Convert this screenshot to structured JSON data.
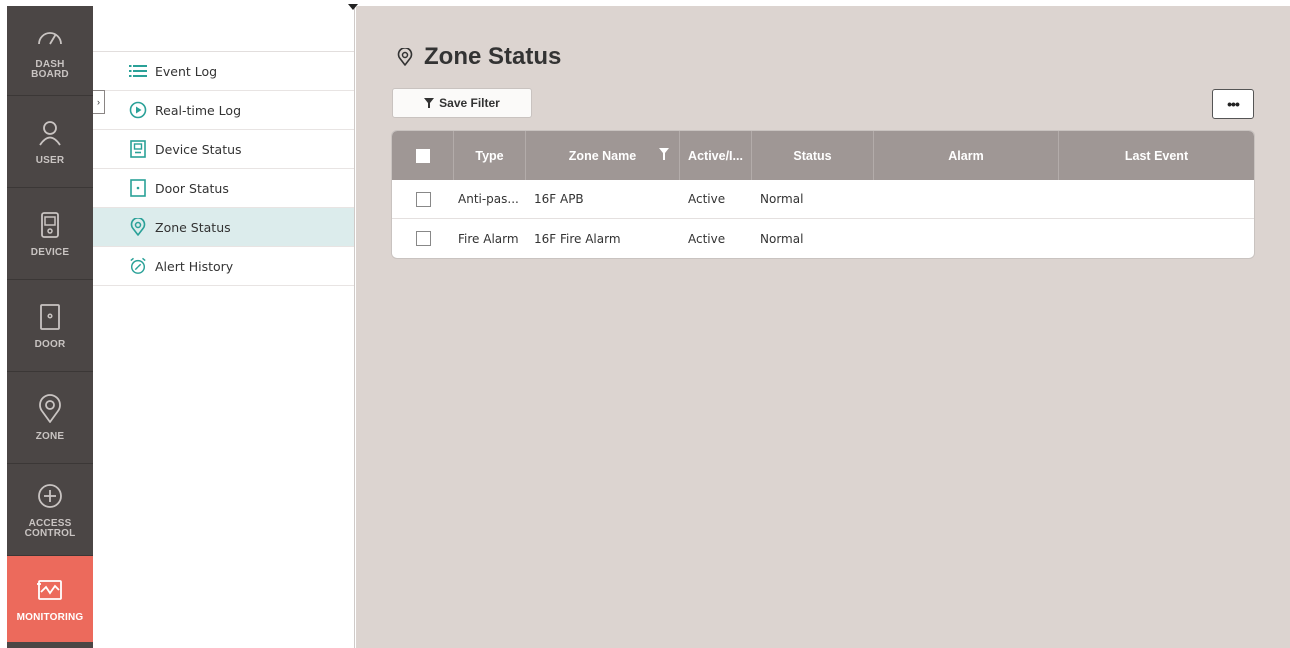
{
  "rail": {
    "items": [
      {
        "label": "DASH\nBOARD",
        "icon": "speedometer-icon"
      },
      {
        "label": "USER",
        "icon": "user-icon"
      },
      {
        "label": "DEVICE",
        "icon": "device-icon"
      },
      {
        "label": "DOOR",
        "icon": "door-icon"
      },
      {
        "label": "ZONE",
        "icon": "location-pin-icon"
      },
      {
        "label": "ACCESS\nCONTROL",
        "icon": "shield-plus-icon"
      },
      {
        "label": "MONITORING",
        "icon": "monitoring-icon",
        "active": true
      }
    ]
  },
  "subnav": {
    "items": [
      {
        "label": "Event Log",
        "icon": "list-icon"
      },
      {
        "label": "Real-time Log",
        "icon": "play-circle-icon"
      },
      {
        "label": "Device Status",
        "icon": "device-status-icon"
      },
      {
        "label": "Door Status",
        "icon": "door-status-icon"
      },
      {
        "label": "Zone Status",
        "icon": "location-pin-icon",
        "active": true
      },
      {
        "label": "Alert History",
        "icon": "alarm-clock-icon"
      }
    ]
  },
  "page": {
    "title": "Zone Status",
    "save_filter_label": "Save Filter",
    "more_label": "•••"
  },
  "table": {
    "columns": [
      "Type",
      "Zone Name",
      "Active/I...",
      "Status",
      "Alarm",
      "Last Event"
    ],
    "rows": [
      {
        "type": "Anti-pas...",
        "zone_name": "16F APB",
        "active": "Active",
        "status": "Normal",
        "alarm": "",
        "last_event": ""
      },
      {
        "type": "Fire Alarm",
        "zone_name": "16F Fire Alarm",
        "active": "Active",
        "status": "Normal",
        "alarm": "",
        "last_event": ""
      }
    ]
  },
  "colors": {
    "rail_bg": "#4b4645",
    "accent_active": "#ec6a5c",
    "teal_icon": "#2aa198",
    "table_header": "#9f9795",
    "main_bg": "#dcd4d0"
  }
}
